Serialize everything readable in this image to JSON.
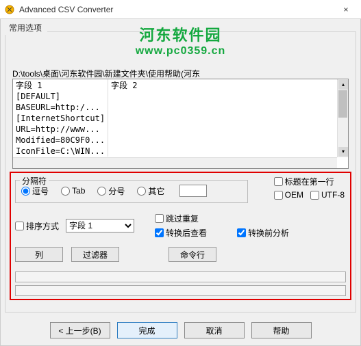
{
  "window": {
    "title": "Advanced CSV Converter",
    "close": "×"
  },
  "watermark": {
    "line1": "河东软件园",
    "line2": "www.pc0359.cn"
  },
  "tab": {
    "label": "常用选项"
  },
  "path": "D:\\tools\\桌面\\河东软件园\\新建文件夹\\使用帮助(河东",
  "grid": {
    "headers": [
      "字段 1",
      "字段 2"
    ],
    "rows": [
      [
        "[DEFAULT]",
        ""
      ],
      [
        "BASEURL=http:/...",
        ""
      ],
      [
        "[InternetShortcut]",
        ""
      ],
      [
        "URL=http://www...",
        ""
      ],
      [
        "Modified=80C9F0...",
        ""
      ],
      [
        "IconFile=C:\\WIN...",
        ""
      ]
    ]
  },
  "delimiter": {
    "group_label": "分隔符",
    "comma": "逗号",
    "tab": "Tab",
    "semicolon": "分号",
    "other": "其它",
    "custom_value": ""
  },
  "checks": {
    "header_first_row": "标题在第一行",
    "oem": "OEM",
    "utf8": "UTF-8",
    "sort": "排序方式",
    "skip_dup": "跳过重复",
    "view_after": "转换后查看",
    "analyze_before": "转换前分析"
  },
  "sort_field": "字段 1",
  "buttons": {
    "columns": "列",
    "filter": "过滤器",
    "cmdline": "命令行"
  },
  "dialog_buttons": {
    "back": "< 上一步(B)",
    "finish": "完成",
    "cancel": "取消",
    "help": "帮助"
  }
}
